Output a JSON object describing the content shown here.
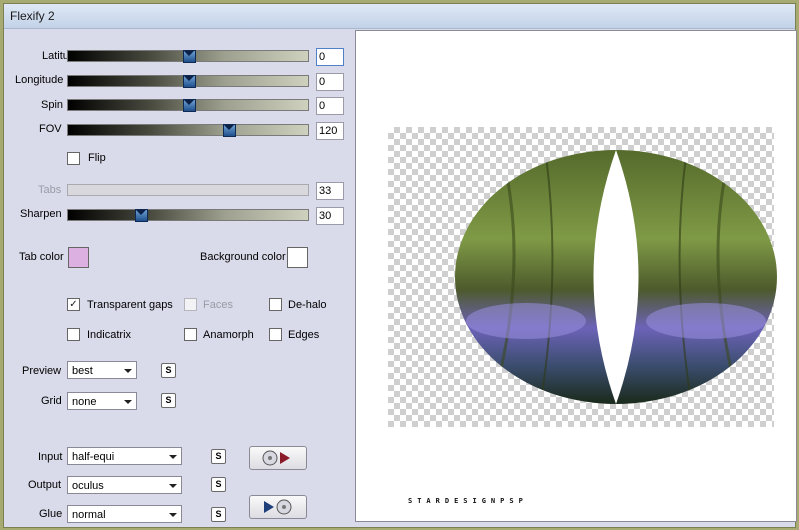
{
  "window": {
    "title": "Flexify 2"
  },
  "sliders": [
    {
      "label": "Latitude",
      "value": "0",
      "fraction": 0.5,
      "disabled": false,
      "focused": true
    },
    {
      "label": "Longitude",
      "value": "0",
      "fraction": 0.5,
      "disabled": false,
      "focused": false
    },
    {
      "label": "Spin",
      "value": "0",
      "fraction": 0.5,
      "disabled": false,
      "focused": false
    },
    {
      "label": "FOV",
      "value": "120",
      "fraction": 0.667,
      "disabled": false,
      "focused": false
    },
    {
      "label": "Tabs",
      "value": "33",
      "fraction": 0.33,
      "disabled": true,
      "focused": false
    },
    {
      "label": "Sharpen",
      "value": "30",
      "fraction": 0.3,
      "disabled": false,
      "focused": false
    }
  ],
  "flip": {
    "label": "Flip",
    "checked": false
  },
  "tab_color": {
    "label": "Tab color",
    "color": "#dcb1e2"
  },
  "background_color": {
    "label": "Background color",
    "color": "#ffffff"
  },
  "options": {
    "transparent_gaps": {
      "label": "Transparent gaps",
      "checked": true
    },
    "faces": {
      "label": "Faces",
      "checked": false,
      "disabled": true
    },
    "de_halo": {
      "label": "De-halo",
      "checked": false
    },
    "indicatrix": {
      "label": "Indicatrix",
      "checked": false
    },
    "anamorph": {
      "label": "Anamorph",
      "checked": false
    },
    "edges": {
      "label": "Edges",
      "checked": false
    }
  },
  "preview_select": {
    "label": "Preview",
    "value": "best"
  },
  "grid_select": {
    "label": "Grid",
    "value": "none"
  },
  "input_select": {
    "label": "Input",
    "value": "half-equi"
  },
  "output_select": {
    "label": "Output",
    "value": "oculus"
  },
  "glue_select": {
    "label": "Glue",
    "value": "normal"
  },
  "s_button": "S",
  "watermark": "STARDESIGNPSP",
  "colors": {
    "dialog_bg": "#dadbea",
    "frame": "#a7ab72",
    "slider_thumb": "#2e63a6"
  }
}
